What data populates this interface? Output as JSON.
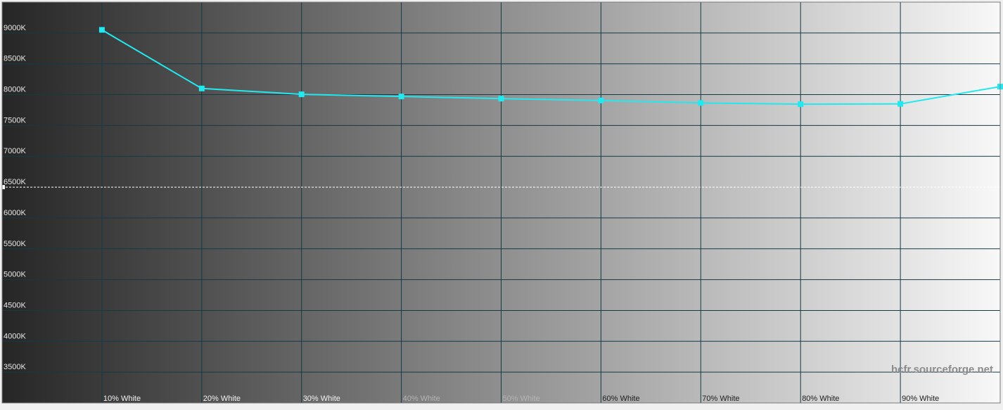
{
  "chart_data": {
    "type": "line",
    "title": "",
    "xlabel": "",
    "ylabel": "",
    "categories": [
      "",
      "10% White",
      "20% White",
      "30% White",
      "40% White",
      "50% White",
      "60% White",
      "70% White",
      "80% White",
      "90% White",
      ""
    ],
    "x": [
      0,
      10,
      20,
      30,
      40,
      50,
      60,
      70,
      80,
      90,
      100
    ],
    "series": [
      {
        "values": [
          null,
          9050,
          8100,
          8005,
          7970,
          7935,
          7905,
          7865,
          7845,
          7850,
          8130
        ]
      }
    ],
    "reference_line": {
      "value": 6500,
      "style": "dashed"
    },
    "ylim": [
      3000,
      9500
    ],
    "yticks": [
      3500,
      4000,
      4500,
      5000,
      5500,
      6000,
      6500,
      7000,
      7500,
      8000,
      8500,
      9000
    ],
    "ytick_labels": [
      "3500K",
      "4000K",
      "4500K",
      "5000K",
      "5500K",
      "6000K",
      "6500K",
      "7000K",
      "7500K",
      "8000K",
      "8500K",
      "9000K"
    ],
    "grid": true,
    "background": "grayscale gradient black to white",
    "line_color": "#22e8f0",
    "grid_color": "#153a44",
    "watermark": "hcfr.sourceforge.net"
  }
}
